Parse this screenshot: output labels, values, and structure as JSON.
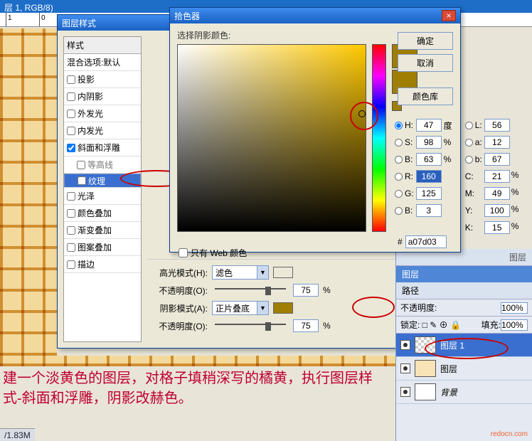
{
  "topbar": {
    "title": "层 1, RGB/8)"
  },
  "layerstyle": {
    "title": "图层样式",
    "side_header": "样式",
    "blend_row": "混合选项:默认",
    "items": [
      {
        "label": "投影",
        "checked": false
      },
      {
        "label": "内阴影",
        "checked": false
      },
      {
        "label": "外发光",
        "checked": false
      },
      {
        "label": "内发光",
        "checked": false
      },
      {
        "label": "斜面和浮雕",
        "checked": true,
        "circled": true
      },
      {
        "label": "等高线",
        "checked": false,
        "indent": true
      },
      {
        "label": "纹理",
        "checked": false,
        "indent": true,
        "selected": true
      },
      {
        "label": "光泽",
        "checked": false
      },
      {
        "label": "颜色叠加",
        "checked": false
      },
      {
        "label": "渐变叠加",
        "checked": false
      },
      {
        "label": "图案叠加",
        "checked": false
      },
      {
        "label": "描边",
        "checked": false
      }
    ],
    "main": {
      "highlight_mode_label": "高光模式(H):",
      "highlight_mode_value": "滤色",
      "highlight_sw": "#ffffff",
      "opacity1_label": "不透明度(O):",
      "opacity1_value": "75",
      "shadow_mode_label": "阴影模式(A):",
      "shadow_mode_value": "正片叠底",
      "shadow_sw": "#a07d03",
      "opacity2_label": "不透明度(O):",
      "opacity2_value": "75",
      "pct": "%"
    }
  },
  "colorpicker": {
    "title": "拾色器",
    "prompt": "选择阴影颜色:",
    "btn_ok": "确定",
    "btn_cancel": "取消",
    "btn_lib": "颜色库",
    "webonly": "只有 Web 颜色",
    "H": "47",
    "deg": "度",
    "S": "98",
    "Bv": "63",
    "L": "56",
    "a": "12",
    "b": "67",
    "R": "160",
    "G": "125",
    "Bc": "3",
    "C": "21",
    "M": "49",
    "Y": "100",
    "K": "15",
    "hex": "a07d03",
    "hash": "#",
    "pct": "%",
    "lbl": {
      "H": "H:",
      "S": "S:",
      "B": "B:",
      "L": "L:",
      "a": "a:",
      "b": "b:",
      "R": "R:",
      "G": "G:",
      "Bc": "B:",
      "C": "C:",
      "M": "M:",
      "Y": "Y:",
      "K": "K:"
    }
  },
  "caption": "建一个淡黄色的图层，对格子填稍深写的橘黄，执行图层样式-斜面和浮雕，阴影改赫色。",
  "layers": {
    "tab_prev": "图层",
    "tab": "图层",
    "tab_path": "路径",
    "opacity_lbl": "不透明度:",
    "opacity_val": "100%",
    "lock_lbl": "锁定:",
    "fill_lbl": "填充:",
    "fill_val": "100%",
    "rows": [
      {
        "name": "图层 1",
        "thumb": "ch",
        "active": true,
        "circled": true
      },
      {
        "name": "图层",
        "thumb": "bei",
        "active": false
      },
      {
        "name": "背景",
        "thumb": "wh",
        "active": false,
        "italic": true
      }
    ]
  },
  "status": "/1.83M",
  "watermark": "redocn.com",
  "ruler": {
    "a": "1",
    "b": "0"
  }
}
